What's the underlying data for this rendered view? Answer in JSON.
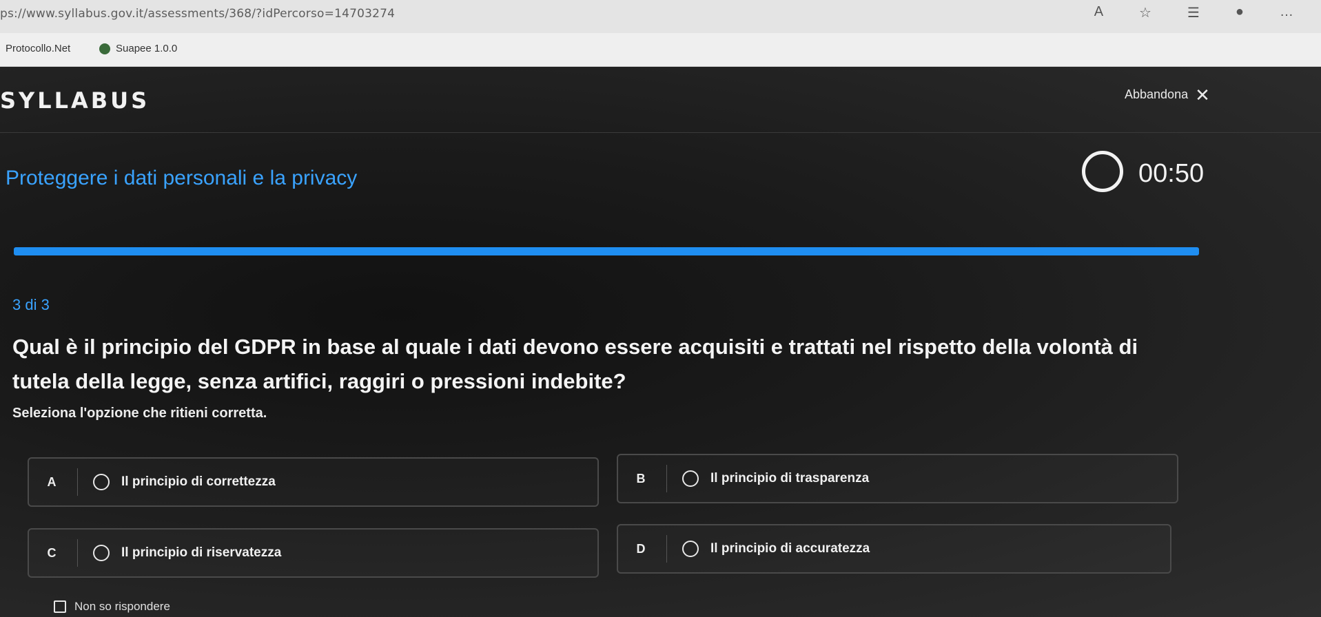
{
  "browser": {
    "url": "ps://www.syllabus.gov.it/assessments/368/?idPercorso=14703274",
    "bookmarks": [
      "Protocollo.Net",
      "Suapee 1.0.0"
    ],
    "icons": [
      "text-size-icon",
      "star-icon",
      "favorites-icon",
      "profile-icon",
      "more-icon"
    ]
  },
  "header": {
    "logo": "SYLLABUS",
    "abandon_label": "Abbandona",
    "close_glyph": "✕"
  },
  "quiz": {
    "title": "Proteggere i dati personali e la privacy",
    "timer": "00:50",
    "progress": 1.0,
    "counter": "3 di 3",
    "question": "Qual è il principio del GDPR in base al quale i dati devono essere acquisiti e trattati nel rispetto della volontà di tutela della legge, senza artifici, raggiri o pressioni indebite?",
    "instruction": "Seleziona l'opzione che ritieni corretta.",
    "options": [
      {
        "letter": "A",
        "label": "Il principio di correttezza"
      },
      {
        "letter": "B",
        "label": "Il principio di trasparenza"
      },
      {
        "letter": "C",
        "label": "Il principio di riservatezza"
      },
      {
        "letter": "D",
        "label": "Il principio di accuratezza"
      }
    ],
    "dont_know": "Non so rispondere"
  },
  "colors": {
    "accent": "#1f8ef1",
    "title": "#3aa3ff"
  }
}
